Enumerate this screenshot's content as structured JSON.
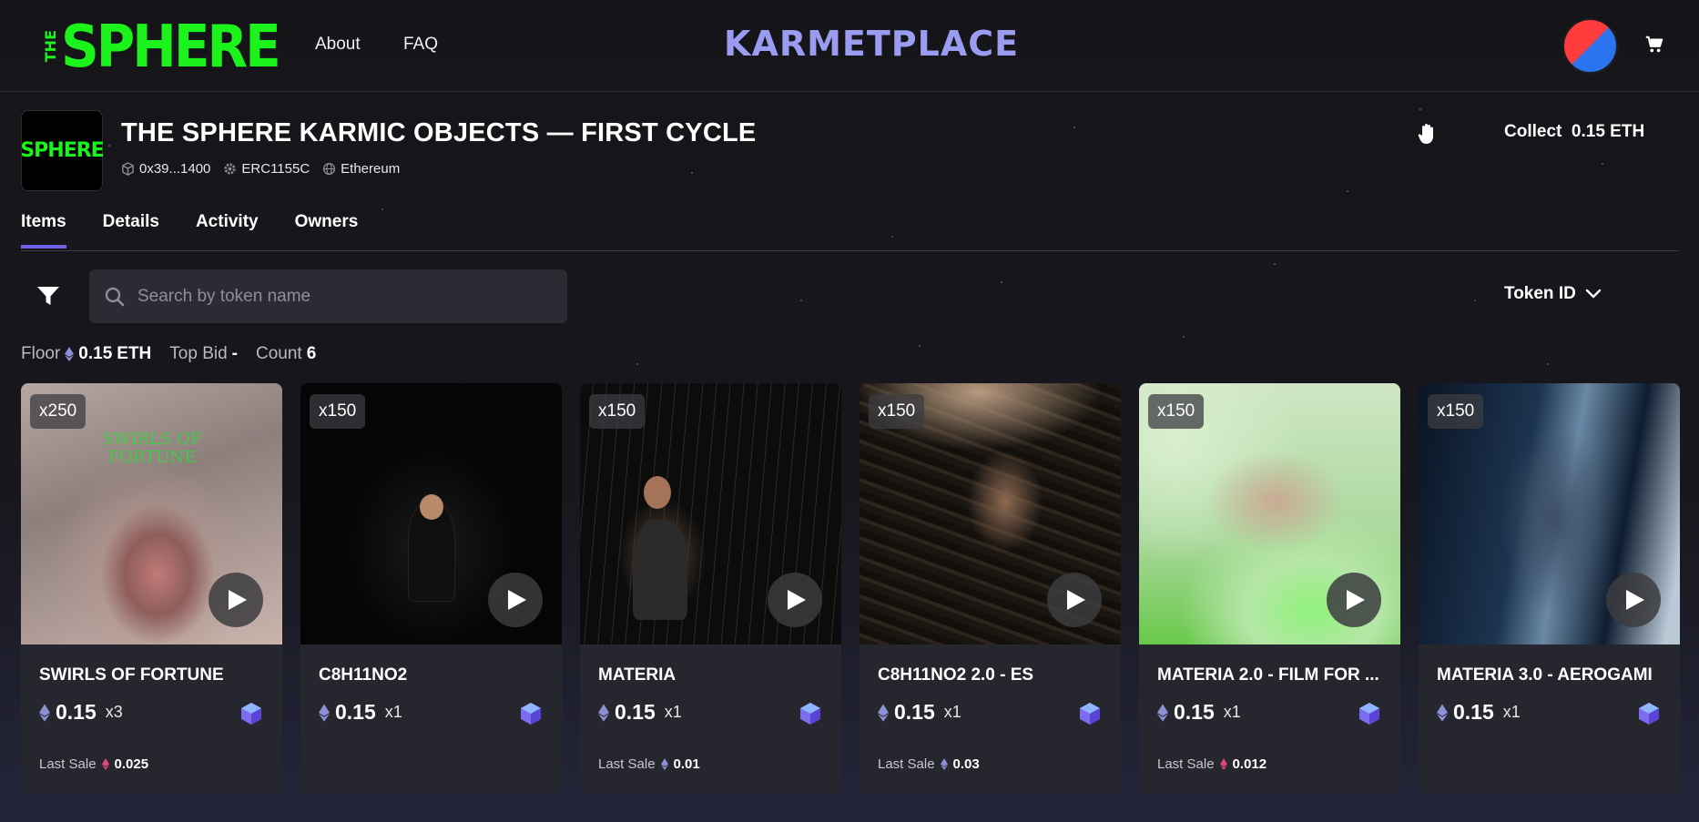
{
  "header": {
    "logo_text": "THE SPHERE",
    "logo_small": "THE",
    "logo_main": "SPHERE",
    "nav": [
      {
        "label": "About"
      },
      {
        "label": "FAQ"
      }
    ],
    "brand": "KARMETPLACE",
    "avatar_colors": [
      "#ff3b3b",
      "#2a74f0"
    ]
  },
  "collection": {
    "title": "THE SPHERE KARMIC OBJECTS — FIRST CYCLE",
    "thumb_text": "SPHERE",
    "contract": "0x39...1400",
    "standard": "ERC1155C",
    "chain": "Ethereum",
    "collect_label": "Collect",
    "collect_price": "0.15 ETH"
  },
  "tabs": [
    {
      "label": "Items",
      "active": true
    },
    {
      "label": "Details",
      "active": false
    },
    {
      "label": "Activity",
      "active": false
    },
    {
      "label": "Owners",
      "active": false
    }
  ],
  "search": {
    "placeholder": "Search by token name",
    "value": ""
  },
  "sort": {
    "label": "Token ID"
  },
  "stats": {
    "floor_label": "Floor",
    "floor_value": "0.15",
    "floor_unit": "ETH",
    "top_bid_label": "Top Bid",
    "top_bid_value": "-",
    "count_label": "Count",
    "count_value": "6"
  },
  "cards": [
    {
      "badge": "x250",
      "title": "SWIRLS OF FORTUNE",
      "price": "0.15",
      "qty": "x3",
      "last_sale_label": "Last Sale",
      "last_sale": "0.025",
      "last_sale_color": "#e2457f",
      "art_text": "SWIRLS OF FORTUNE"
    },
    {
      "badge": "x150",
      "title": "C8H11NO2",
      "price": "0.15",
      "qty": "x1",
      "last_sale_label": "",
      "last_sale": ""
    },
    {
      "badge": "x150",
      "title": "MATERIA",
      "price": "0.15",
      "qty": "x1",
      "last_sale_label": "Last Sale",
      "last_sale": "0.01",
      "last_sale_color": "#8e90d6"
    },
    {
      "badge": "x150",
      "title": "C8H11NO2 2.0 - ES",
      "price": "0.15",
      "qty": "x1",
      "last_sale_label": "Last Sale",
      "last_sale": "0.03",
      "last_sale_color": "#8e90d6"
    },
    {
      "badge": "x150",
      "title": "MATERIA 2.0 - FILM FOR ...",
      "price": "0.15",
      "qty": "x1",
      "last_sale_label": "Last Sale",
      "last_sale": "0.012",
      "last_sale_color": "#e2457f"
    },
    {
      "badge": "x150",
      "title": "MATERIA 3.0 - AEROGAMI",
      "price": "0.15",
      "qty": "x1",
      "last_sale_label": "",
      "last_sale": ""
    }
  ],
  "colors": {
    "accent": "#6d5fe6",
    "brand": "#9a9cf2",
    "logo_green": "#1cf31c"
  }
}
